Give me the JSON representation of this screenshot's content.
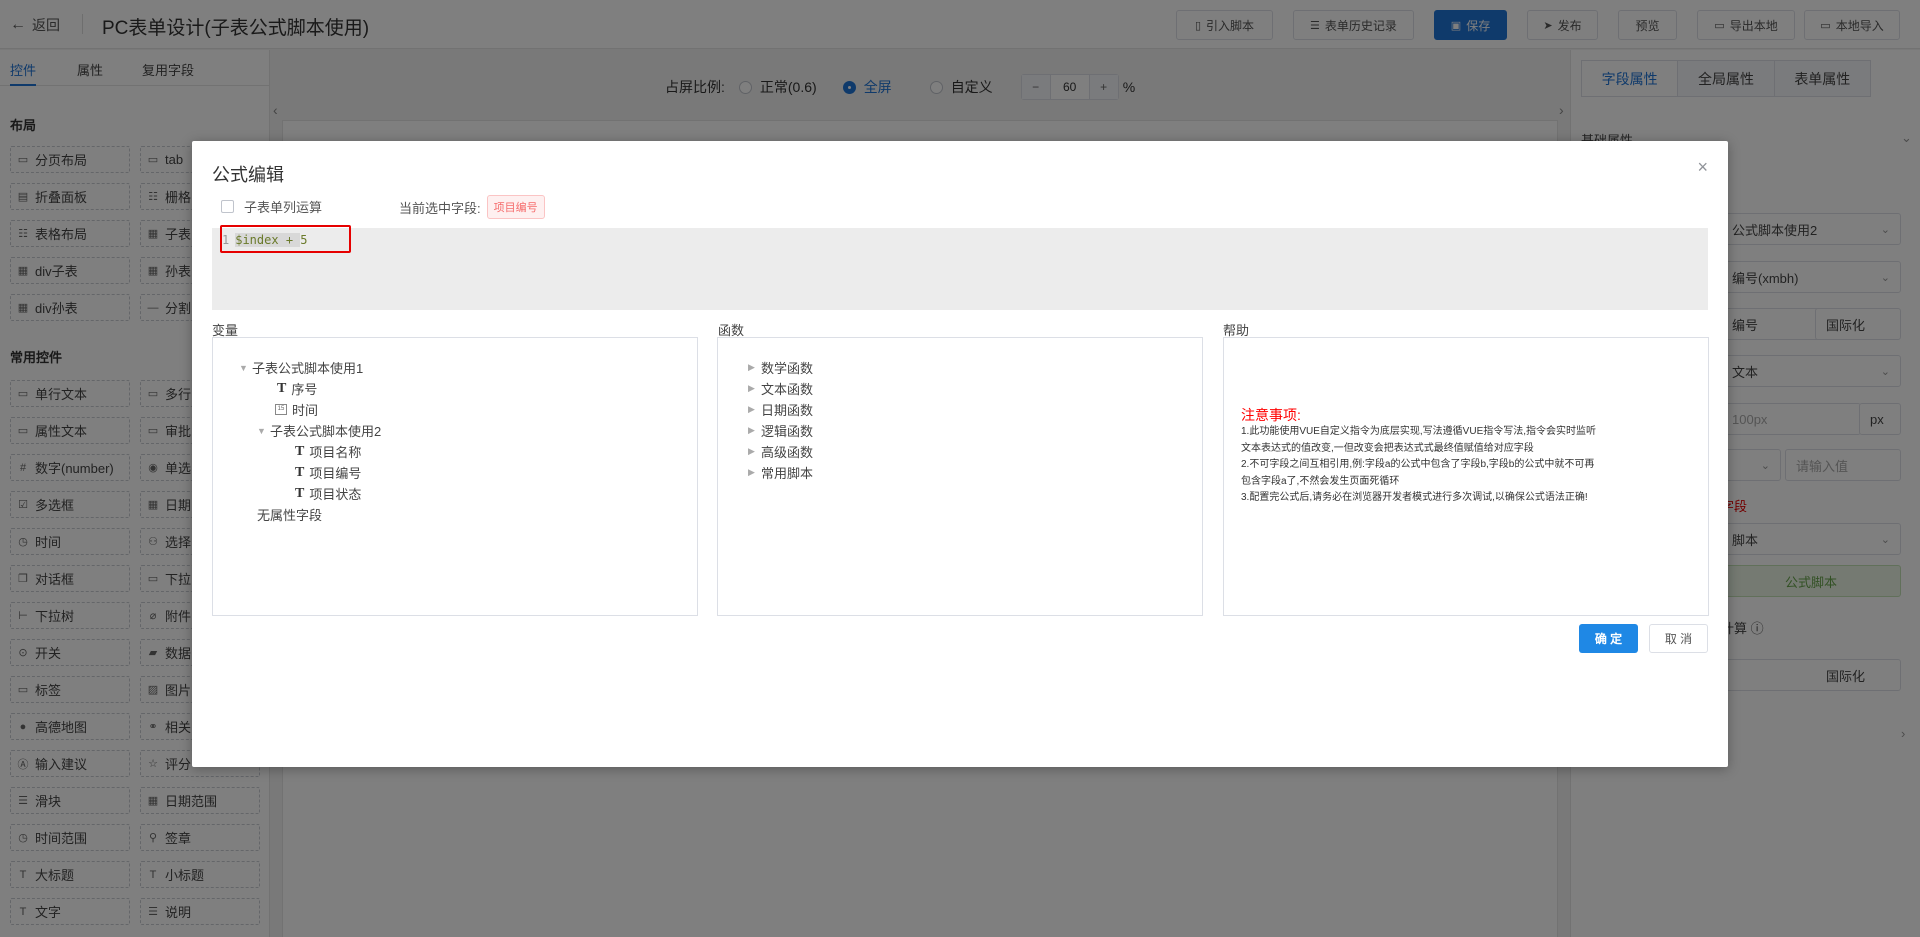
{
  "header": {
    "back_label": "返回",
    "title": "PC表单设计(子表公式脚本使用)",
    "buttons": {
      "import_script": "引入脚本",
      "history": "表单历史记录",
      "save": "保存",
      "publish": "发布",
      "preview": "预览",
      "export": "导出本地",
      "import_local": "本地导入"
    }
  },
  "left": {
    "tabs": [
      "控件",
      "属性",
      "复用字段"
    ],
    "layout_title": "布局",
    "layout_items": [
      "分页布局",
      "tab",
      "折叠面板",
      "栅格",
      "表格布局",
      "子表",
      "div子表",
      "孙表",
      "div孙表",
      "分割"
    ],
    "common_title": "常用控件",
    "common_items": [
      "单行文本",
      "多行",
      "属性文本",
      "审批",
      "数字(number)",
      "单选",
      "多选框",
      "日期",
      "时间",
      "选择",
      "对话框",
      "下拉",
      "下拉树",
      "附件",
      "开关",
      "数据",
      "标签",
      "图片",
      "高德地图",
      "相关",
      "输入建议",
      "评分",
      "滑块",
      "日期范围",
      "时间范围",
      "签章",
      "大标题",
      "小标题",
      "文字",
      "说明"
    ]
  },
  "canvas": {
    "scale_label": "占屏比例:",
    "options": [
      "正常(0.6)",
      "全屏",
      "自定义"
    ],
    "selected": "全屏",
    "custom_value": "60",
    "minus": "−",
    "plus": "+",
    "percent": "%"
  },
  "right": {
    "tabs": [
      "字段属性",
      "全局属性",
      "表单属性"
    ],
    "section": "基础属性",
    "select_parent": "公式脚本使用2",
    "field_id": "编号(xmbh)",
    "field_name": "编号",
    "i18n": "国际化",
    "type": "文本",
    "width_placeholder": "100px",
    "px": "px",
    "input_placeholder": "请输入值",
    "warn": "字段",
    "script_type": "脚本",
    "formula_btn": "公式脚本",
    "calc": "计算",
    "i18n2": "国际化"
  },
  "modal": {
    "title": "公式编辑",
    "close": "×",
    "subtable_check": "子表单列运算",
    "current_label": "当前选中字段:",
    "current_tag": "项目编号",
    "editor": {
      "line_no": "1",
      "code_var": "$index",
      "code_op": " + ",
      "code_num": "5"
    },
    "variables_label": "变量",
    "functions_label": "函数",
    "help_label": "帮助",
    "var_tree": {
      "root": "子表公式脚本使用1",
      "seq": "序号",
      "time": "时间",
      "sub": "子表公式脚本使用2",
      "f1": "项目名称",
      "f2": "项目编号",
      "f3": "项目状态",
      "none": "无属性字段"
    },
    "functions": [
      "数学函数",
      "文本函数",
      "日期函数",
      "逻辑函数",
      "高级函数",
      "常用脚本"
    ],
    "help": {
      "title": "注意事项:",
      "lines": [
        "1.此功能使用VUE自定义指令为底层实现,写法遵循VUE指令写法,指令会实时监听文本表达式的值改变,一但改变会把表达式式最终值赋值给对应字段",
        "2.不可字段之间互相引用,例:字段a的公式中包含了字段b,字段b的公式中就不可再包含字段a了,不然会发生页面死循环",
        "3.配置完公式后,请务必在浏览器开发者模式进行多次调试,以确保公式语法正确!"
      ]
    },
    "ok": "确 定",
    "cancel": "取 消"
  }
}
